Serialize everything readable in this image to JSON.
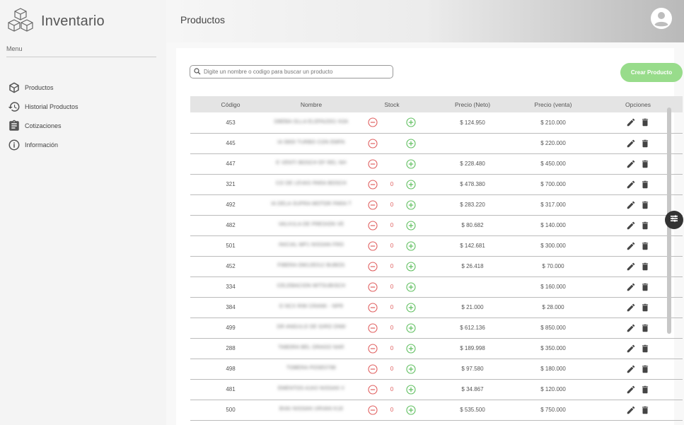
{
  "app": {
    "title": "Inventario"
  },
  "sidebar": {
    "menu_label": "Menu",
    "items": [
      {
        "label": "Productos",
        "icon": "cube-icon"
      },
      {
        "label": "Historial Productos",
        "icon": "history-icon"
      },
      {
        "label": "Cotizaciones",
        "icon": "clipboard-icon"
      },
      {
        "label": "Información",
        "icon": "info-icon"
      }
    ]
  },
  "header": {
    "title": "Productos"
  },
  "toolbar": {
    "search_placeholder": "Digite un nombre o codigo para buscar un producto",
    "create_label": "Crear Producto"
  },
  "colors": {
    "accent_green": "#98dc8b",
    "minus_red": "#e06060",
    "plus_green": "#5fbf5f"
  },
  "table": {
    "headers": [
      "Código",
      "Nombre",
      "Stock",
      "Precio (Neto)",
      "Precio (venta)",
      "Opciones"
    ],
    "rows": [
      {
        "code": "453",
        "name": "DBEBA OLLA ELEPA2001 K0A",
        "stock": "",
        "neto": "$ 124.950",
        "venta": "$ 210.000"
      },
      {
        "code": "445",
        "name": "IA 5800 TURBO CON EMPA",
        "stock": "",
        "neto": "",
        "venta": "$ 220.000"
      },
      {
        "code": "447",
        "name": "E VENTI BOSCH EF REL NH",
        "stock": "",
        "neto": "$ 228.480",
        "venta": "$ 450.000"
      },
      {
        "code": "321",
        "name": "CO DE LEVAS PARA BOSCH",
        "stock": "0",
        "neto": "$ 478.380",
        "venta": "$ 700.000"
      },
      {
        "code": "492",
        "name": "IA DELA SUPRA MOTOR PARA T",
        "stock": "0",
        "neto": "$ 283.220",
        "venta": "$ 317.000"
      },
      {
        "code": "482",
        "name": "VALVULA DE PRESION VE",
        "stock": "0",
        "neto": "$ 80.682",
        "venta": "$ 140.000"
      },
      {
        "code": "501",
        "name": "INICIAL MP1 NISSAN FRO",
        "stock": "0",
        "neto": "$ 142.681",
        "venta": "$ 300.000"
      },
      {
        "code": "452",
        "name": "FIBERA OM12E012 BUBOS",
        "stock": "0",
        "neto": "$ 26.418",
        "venta": "$ 70.000"
      },
      {
        "code": "334",
        "name": "CELEBACION MITSUBISCH",
        "stock": "0",
        "neto": "",
        "venta": "$ 160.000"
      },
      {
        "code": "384",
        "name": "O NCX RIM CRANK - NPR",
        "stock": "0",
        "neto": "$ 21.000",
        "venta": "$ 28.000"
      },
      {
        "code": "499",
        "name": "DR ANGULO DE GIRO DNM",
        "stock": "0",
        "neto": "$ 612.136",
        "venta": "$ 850.000"
      },
      {
        "code": "288",
        "name": "TABORA BEL DRAGO NAR",
        "stock": "0",
        "neto": "$ 189.998",
        "venta": "$ 350.000"
      },
      {
        "code": "498",
        "name": "TOBERA POSE0798",
        "stock": "0",
        "neto": "$ 97.580",
        "venta": "$ 180.000"
      },
      {
        "code": "481",
        "name": "EMENTOS A1K0 NISSAN V",
        "stock": "0",
        "neto": "$ 34.867",
        "venta": "$ 120.000"
      },
      {
        "code": "500",
        "name": "BVAI NISSAN URVAN K18",
        "stock": "0",
        "neto": "$ 535.500",
        "venta": "$ 750.000"
      }
    ]
  }
}
